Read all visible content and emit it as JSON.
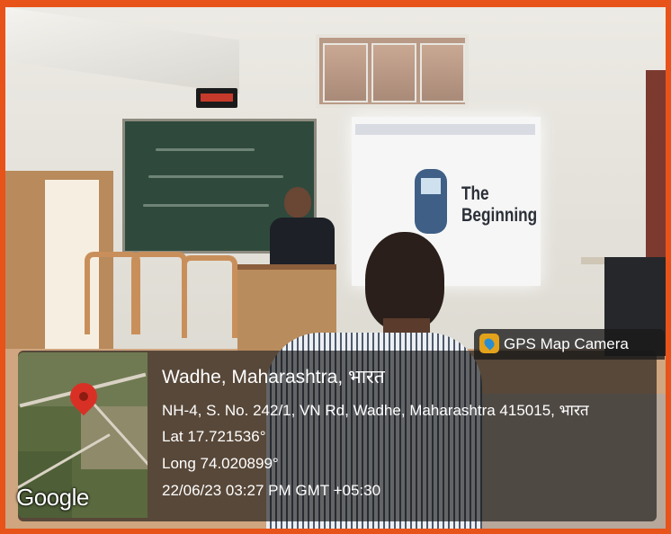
{
  "slide": {
    "title_line1": "The",
    "title_line2": "Beginning"
  },
  "badge": {
    "label": "GPS Map Camera",
    "icon": "gps-map-camera-icon"
  },
  "geotag": {
    "place": "Wadhe, Maharashtra, भारत",
    "address": "NH-4, S. No. 242/1, VN Rd, Wadhe, Maharashtra 415015, भारत",
    "latitude": "Lat 17.721536°",
    "longitude": "Long 74.020899°",
    "timestamp": "22/06/23 03:27 PM GMT +05:30"
  },
  "map": {
    "attribution": "Google",
    "pin_icon": "map-pin-icon",
    "pin_color": "#d93025"
  },
  "colors": {
    "frame": "#e8531a",
    "overlay": "#0f0f0f"
  }
}
